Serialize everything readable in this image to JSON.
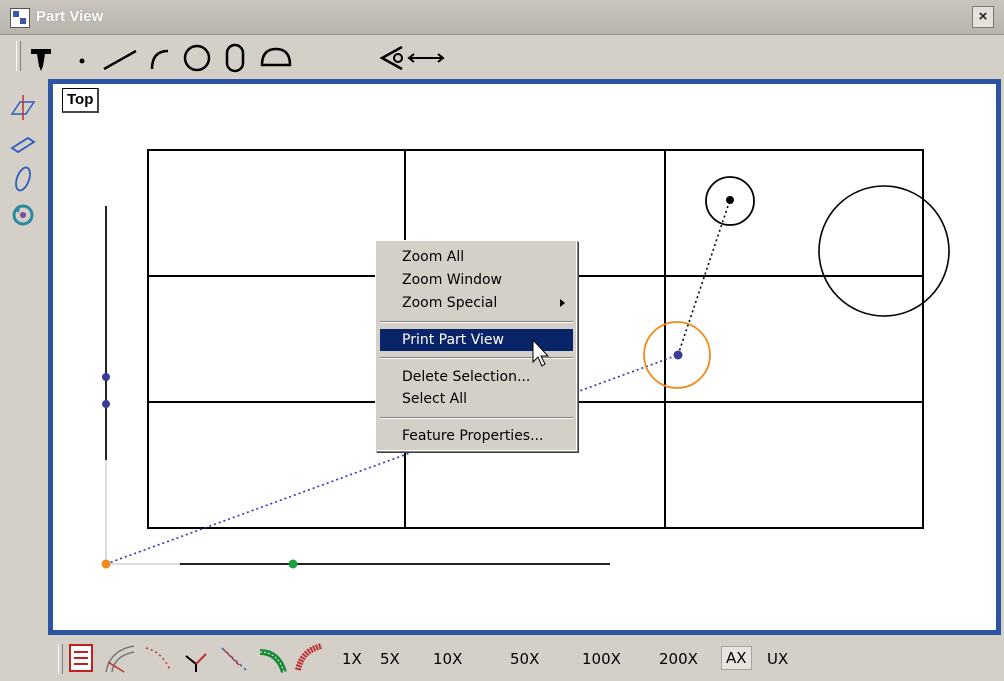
{
  "window": {
    "title": "Part View",
    "close_glyph": "×"
  },
  "top_toolbar": {
    "tools": [
      "probe-icon",
      "point-icon",
      "line-icon",
      "arc-icon",
      "circle-icon",
      "slot-icon",
      "half-circle-icon",
      "distance-icon"
    ]
  },
  "left_toolbar": {
    "tools": [
      "plane-icon",
      "rectangle-icon",
      "cylinder-icon",
      "rotate-icon"
    ]
  },
  "view": {
    "label": "Top"
  },
  "context_menu": {
    "items": [
      {
        "label": "Zoom All"
      },
      {
        "label": "Zoom Window"
      },
      {
        "label": "Zoom Special",
        "submenu": true
      },
      {
        "label": "Print Part View",
        "highlighted": true
      },
      {
        "label": "Delete Selection..."
      },
      {
        "label": "Select All"
      },
      {
        "label": "Feature Properties..."
      }
    ]
  },
  "bottom_toolbar": {
    "zoom": [
      "1X",
      "5X",
      "10X",
      "50X",
      "100X",
      "200X",
      "AX",
      "UX"
    ],
    "selected_zoom": "AX"
  },
  "colors": {
    "frame_border": "#2d54a3",
    "menu_highlight": "#0a246a",
    "orange_point": "#f28a1a",
    "green_point": "#1aa040",
    "blue_point": "#3a3a9a"
  }
}
